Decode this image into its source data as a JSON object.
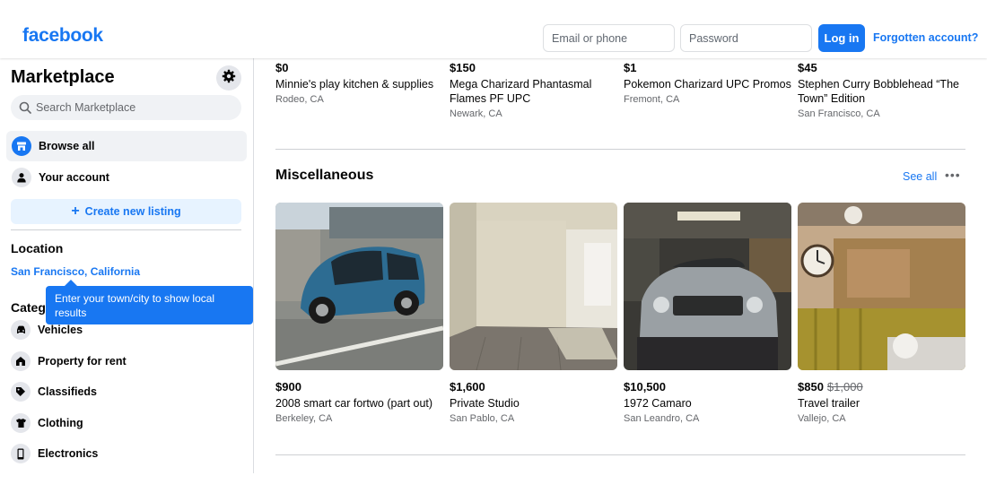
{
  "header": {
    "logo": "facebook",
    "email_placeholder": "Email or phone",
    "password_placeholder": "Password",
    "login_label": "Log in",
    "forgot_label": "Forgotten account?"
  },
  "sidebar": {
    "title": "Marketplace",
    "search_placeholder": "Search Marketplace",
    "nav": [
      {
        "label": "Browse all",
        "icon": "storefront-icon",
        "active": true
      },
      {
        "label": "Your account",
        "icon": "person-icon",
        "active": false
      }
    ],
    "create_label": "Create new listing",
    "location_heading": "Location",
    "location_value": "San Francisco, California",
    "tooltip": "Enter your town/city to show local results",
    "categories_heading": "Categories",
    "categories": [
      {
        "label": "Vehicles",
        "icon": "car-icon"
      },
      {
        "label": "Property for rent",
        "icon": "house-icon"
      },
      {
        "label": "Classifieds",
        "icon": "tag-icon"
      },
      {
        "label": "Clothing",
        "icon": "shirt-icon"
      },
      {
        "label": "Electronics",
        "icon": "phone-icon"
      }
    ]
  },
  "top_listings": [
    {
      "price": "$0",
      "title": "Minnie's play kitchen & supplies",
      "location": "Rodeo, CA"
    },
    {
      "price": "$150",
      "title": "Mega Charizard Phantasmal Flames PF UPC",
      "location": "Newark, CA"
    },
    {
      "price": "$1",
      "title": "Pokemon Charizard UPC Promos",
      "location": "Fremont, CA"
    },
    {
      "price": "$45",
      "title": "Stephen Curry Bobblehead “The Town” Edition",
      "location": "San Francisco, CA"
    }
  ],
  "section": {
    "title": "Miscellaneous",
    "see_all": "See all",
    "more": "•••"
  },
  "misc_listings": [
    {
      "price": "$900",
      "old_price": "",
      "title": "2008 smart car fortwo (part out)",
      "location": "Berkeley, CA"
    },
    {
      "price": "$1,600",
      "old_price": "",
      "title": "Private Studio",
      "location": "San Pablo, CA"
    },
    {
      "price": "$10,500",
      "old_price": "",
      "title": "1972 Camaro",
      "location": "San Leandro, CA"
    },
    {
      "price": "$850",
      "old_price": "$1,000",
      "title": "Travel trailer",
      "location": "Vallejo, CA"
    }
  ],
  "colors": {
    "brand": "#1877f2",
    "tooltip_bg": "#1877f2",
    "active_nav_bg": "#f0f2f5"
  }
}
